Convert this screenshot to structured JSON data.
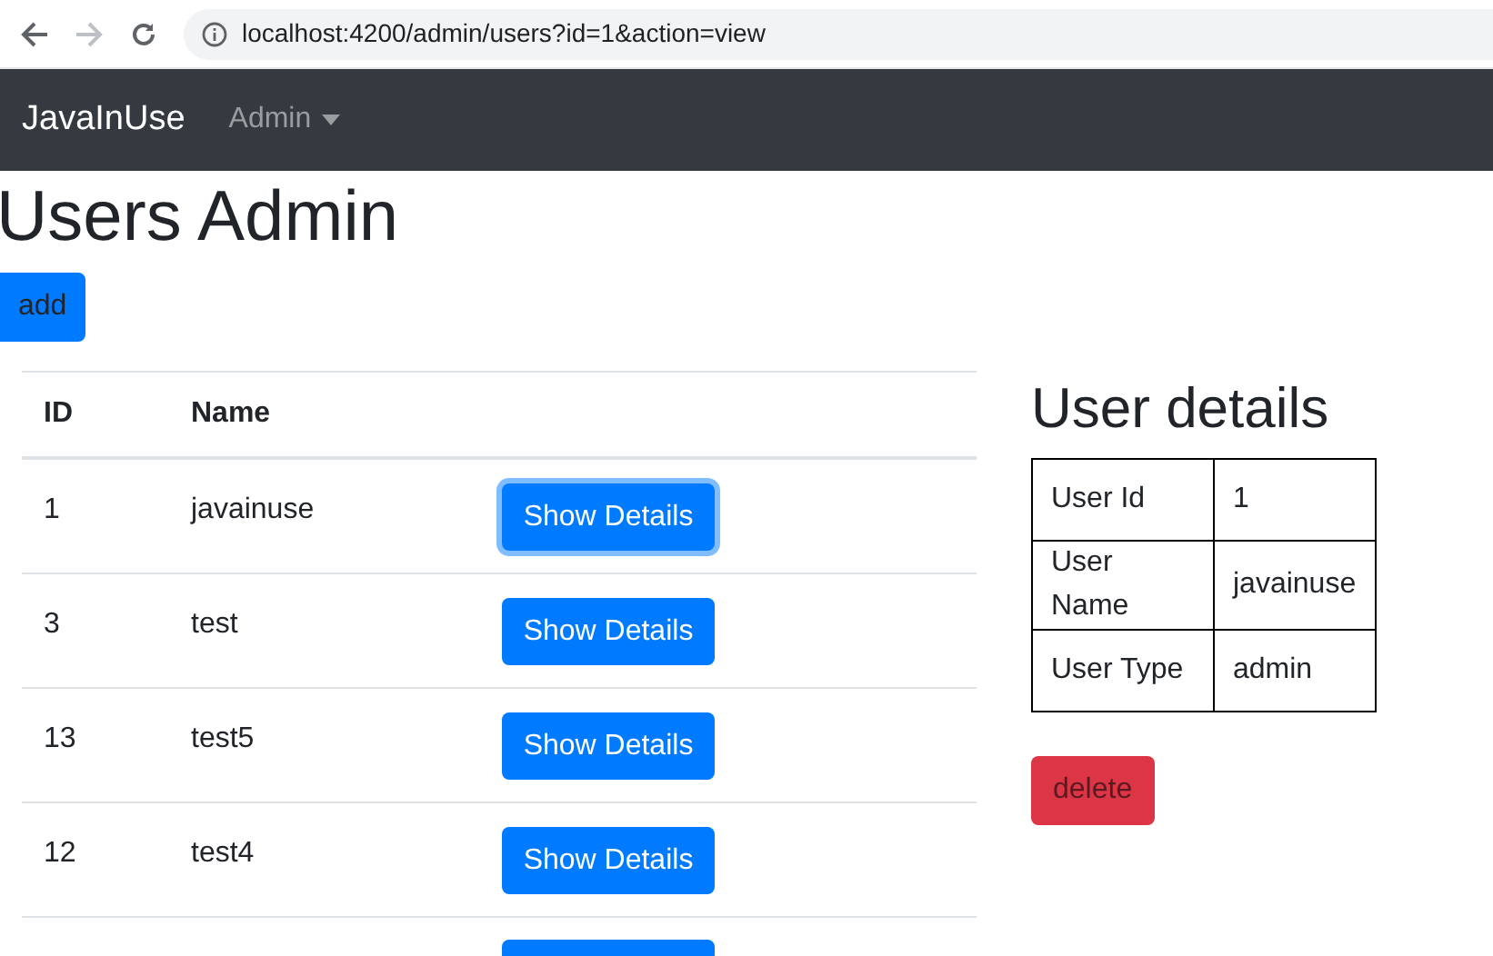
{
  "browser": {
    "url": "localhost:4200/admin/users?id=1&action=view"
  },
  "navbar": {
    "brand": "JavaInUse",
    "menu": "Admin"
  },
  "title": "Users Admin",
  "add_button": "add",
  "table": {
    "columns": [
      "ID",
      "Name"
    ],
    "rows": [
      {
        "kind": "row",
        "id": "1",
        "name": "javainuse",
        "button": "Show Details",
        "focused": true
      },
      {
        "kind": "row",
        "id": "3",
        "name": "test",
        "button": "Show Details",
        "focused": false
      },
      {
        "kind": "row",
        "id": "13",
        "name": "test5",
        "button": "Show Details",
        "focused": false
      },
      {
        "kind": "row",
        "id": "12",
        "name": "test4",
        "button": "Show Details",
        "focused": false
      },
      {
        "kind": "cut_off"
      }
    ]
  },
  "details": {
    "title": "User details",
    "rows": [
      {
        "label": "User Id",
        "value": "1"
      },
      {
        "label": "User Name",
        "value": "javainuse"
      },
      {
        "label": "User Type",
        "value": "admin"
      }
    ],
    "delete_button": "delete"
  }
}
